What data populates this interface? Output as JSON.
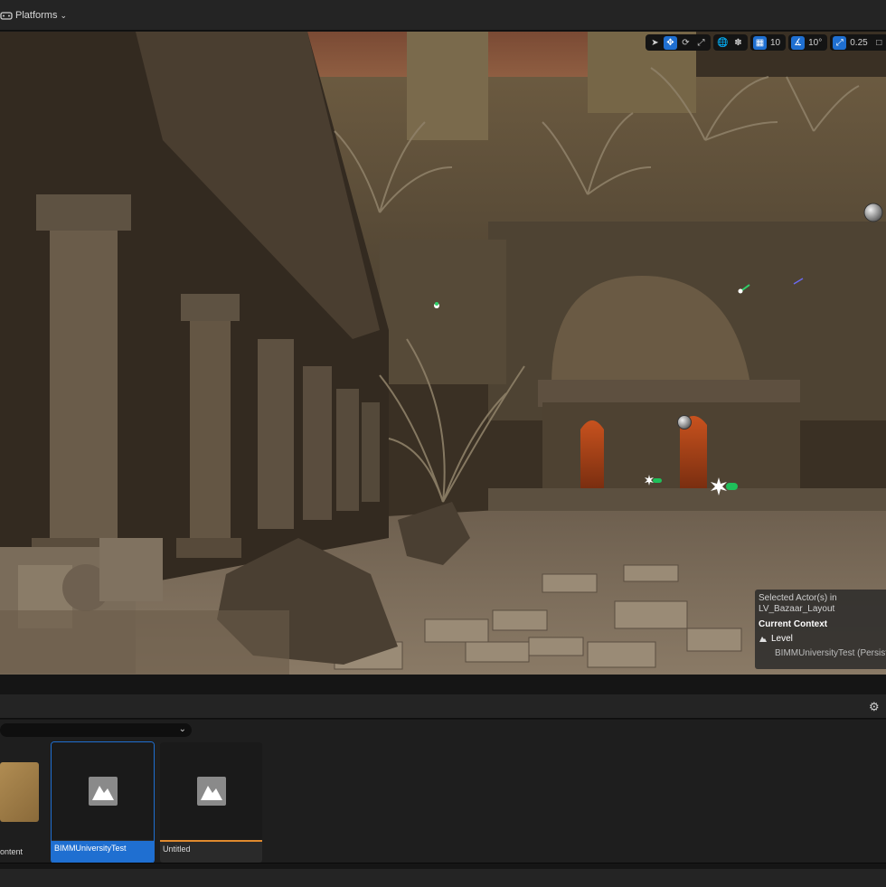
{
  "toolbar": {
    "platforms_label": "Platforms"
  },
  "viewport_tools": {
    "grid_snap_value": "10",
    "rotation_snap_value": "10°",
    "scale_snap_value": "0.25"
  },
  "info_overlay": {
    "selected_actor_line1": "Selected Actor(s) in",
    "selected_actor_line2": "LV_Bazaar_Layout",
    "current_context_label": "Current Context",
    "level_label": "Level",
    "level_name": "BIMMUniversityTest (Persist"
  },
  "content_browser": {
    "folder_label": "ontent",
    "assets": [
      {
        "name": "BIMMUniversityTest",
        "selected": true
      },
      {
        "name": "Untitled",
        "selected": false
      }
    ]
  },
  "colors": {
    "accent": "#1f6fd1",
    "unsaved_bar": "#e08a2e"
  }
}
